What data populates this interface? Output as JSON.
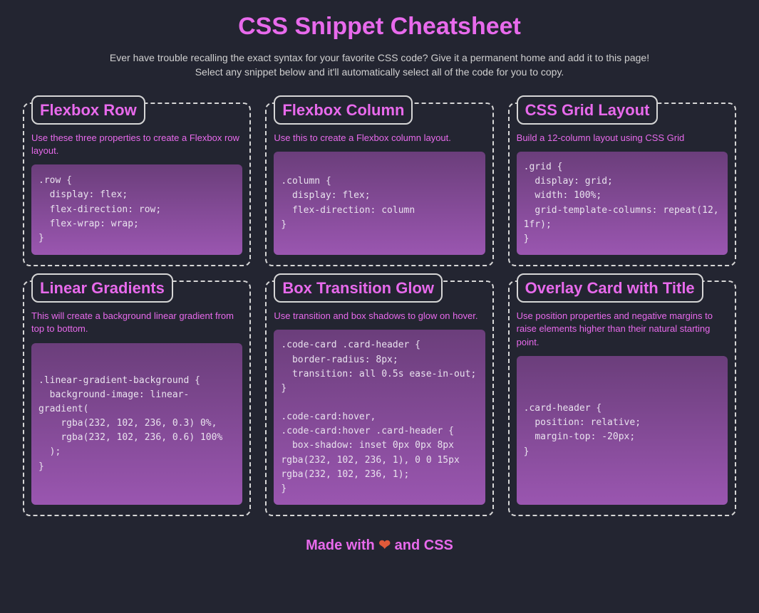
{
  "header": {
    "title": "CSS Snippet Cheatsheet",
    "subtitle": "Ever have trouble recalling the exact syntax for your favorite CSS code? Give it a permanent home and add it to this page! Select any snippet below and it'll automatically select all of the code for you to copy."
  },
  "cards": {
    "c0": {
      "title": "Flexbox Row",
      "desc": "Use these three properties to create a Flexbox row layout.",
      "code": ".row {\n  display: flex;\n  flex-direction: row;\n  flex-wrap: wrap;\n}"
    },
    "c1": {
      "title": "Flexbox Column",
      "desc": "Use this to create a Flexbox column layout.",
      "code": ".column {\n  display: flex;\n  flex-direction: column\n}"
    },
    "c2": {
      "title": "CSS Grid Layout",
      "desc": "Build a 12-column layout using CSS Grid",
      "code": ".grid {\n  display: grid;\n  width: 100%;\n  grid-template-columns: repeat(12, 1fr);\n}"
    },
    "c3": {
      "title": "Linear Gradients",
      "desc": "This will create a background linear gradient from top to bottom.",
      "code": ".linear-gradient-background {\n  background-image: linear-gradient(\n    rgba(232, 102, 236, 0.3) 0%,\n    rgba(232, 102, 236, 0.6) 100%\n  );\n}"
    },
    "c4": {
      "title": "Box Transition Glow",
      "desc": "Use transition and box shadows to glow on hover.",
      "code": ".code-card .card-header {\n  border-radius: 8px;\n  transition: all 0.5s ease-in-out;\n}\n\n.code-card:hover,\n.code-card:hover .card-header {\n  box-shadow: inset 0px 0px 8px rgba(232, 102, 236, 1), 0 0 15px rgba(232, 102, 236, 1);\n}"
    },
    "c5": {
      "title": "Overlay Card with Title",
      "desc": "Use position properties and negative margins to raise elements higher than their natural starting point.",
      "code": ".card-header {\n  position: relative;\n  margin-top: -20px;\n}"
    }
  },
  "footer": {
    "prefix": "Made with ",
    "heart": "❤",
    "suffix": " and CSS"
  }
}
